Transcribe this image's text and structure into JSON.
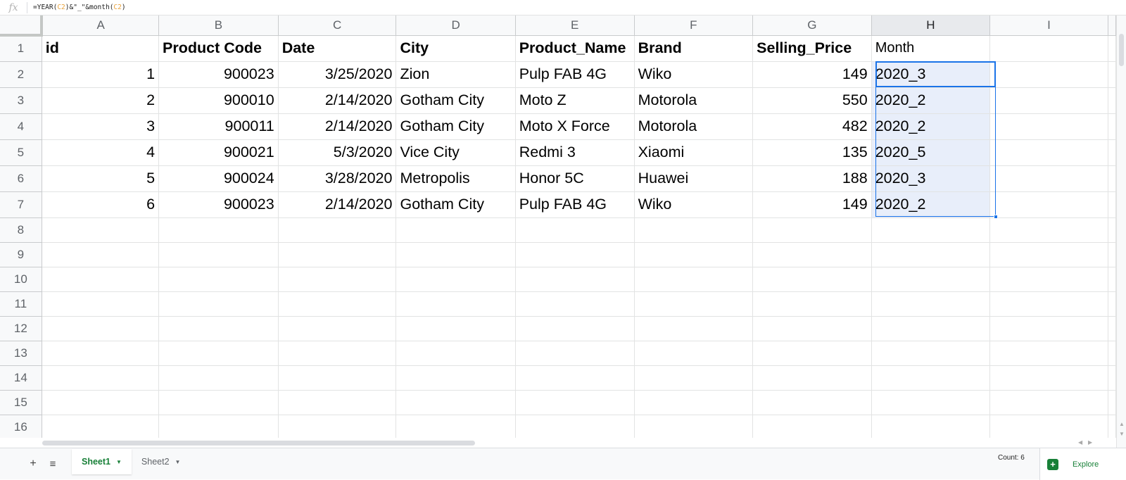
{
  "formula_bar": {
    "fx_label": "fx",
    "formula_parts": [
      "=YEAR(",
      "C2",
      ")&\"_\"&month(",
      "C2",
      ")"
    ]
  },
  "columns": [
    "A",
    "B",
    "C",
    "D",
    "E",
    "F",
    "G",
    "H",
    "I"
  ],
  "selected_column": "H",
  "rows": [
    {
      "num": "1",
      "cells": [
        "id",
        "Product Code",
        "Date",
        "City",
        "Product_Name",
        "Brand",
        "Selling_Price",
        "Month",
        ""
      ]
    },
    {
      "num": "2",
      "cells": [
        "1",
        "900023",
        "3/25/2020",
        "Zion",
        "Pulp FAB 4G",
        "Wiko",
        "149",
        "2020_3",
        ""
      ]
    },
    {
      "num": "3",
      "cells": [
        "2",
        "900010",
        "2/14/2020",
        "Gotham City",
        "Moto Z",
        "Motorola",
        "550",
        "2020_2",
        ""
      ]
    },
    {
      "num": "4",
      "cells": [
        "3",
        "900011",
        "2/14/2020",
        "Gotham City",
        "Moto X Force",
        "Motorola",
        "482",
        "2020_2",
        ""
      ]
    },
    {
      "num": "5",
      "cells": [
        "4",
        "900021",
        "5/3/2020",
        "Vice City",
        "Redmi 3",
        "Xiaomi",
        "135",
        "2020_5",
        ""
      ]
    },
    {
      "num": "6",
      "cells": [
        "5",
        "900024",
        "3/28/2020",
        "Metropolis",
        "Honor 5C",
        "Huawei",
        "188",
        "2020_3",
        ""
      ]
    },
    {
      "num": "7",
      "cells": [
        "6",
        "900023",
        "2/14/2020",
        "Gotham City",
        "Pulp FAB 4G",
        "Wiko",
        "149",
        "2020_2",
        ""
      ]
    }
  ],
  "empty_rows": [
    "8",
    "9",
    "10",
    "11",
    "12",
    "13",
    "14",
    "15",
    "16"
  ],
  "sheets": {
    "add_label": "+",
    "list_label": "≡",
    "tabs": [
      "Sheet1",
      "Sheet2"
    ],
    "active": "Sheet1"
  },
  "status": {
    "count": "Count: 6"
  },
  "explore": {
    "label": "Explore",
    "icon": "explore-icon",
    "accent": "#188038"
  },
  "colors": {
    "selection": "#1a73e8",
    "selection_fill": "#e8eefa"
  }
}
